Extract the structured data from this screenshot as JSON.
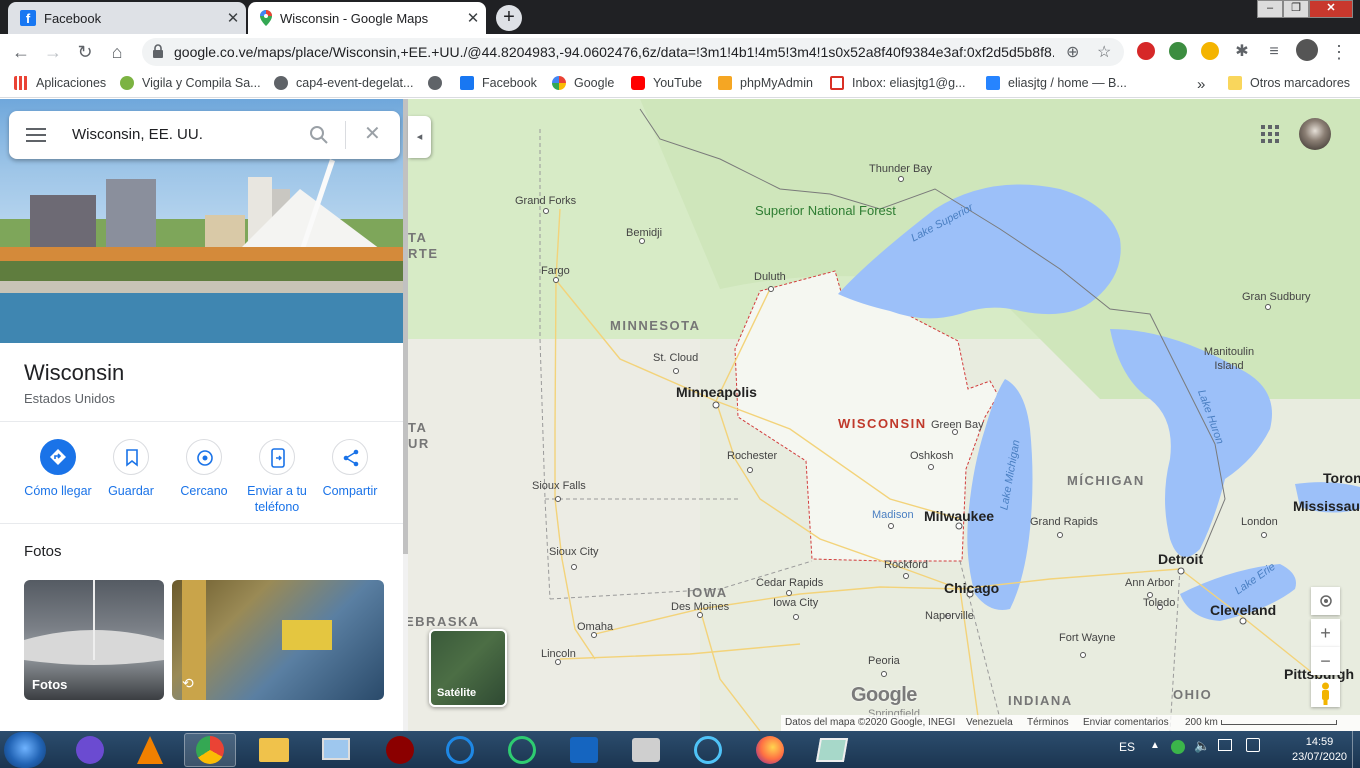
{
  "browser": {
    "tabs": [
      {
        "title": "Facebook"
      },
      {
        "title": "Wisconsin - Google Maps"
      }
    ],
    "url": "google.co.ve/maps/place/Wisconsin,+EE.+UU./@44.8204983,-94.0602476,6z/data=!3m1!4b1!4m5!3m4!1s0x52a8f40f9384e3af:0xf2d5d5b8f8...",
    "bookmarks": [
      "Aplicaciones",
      "Vigila y Compila Sa...",
      "cap4-event-degelat...",
      "Facebook",
      "Google",
      "YouTube",
      "phpMyAdmin",
      "Inbox: eliasjtg1@g...",
      "eliasjtg / home — B...",
      "Otros marcadores"
    ],
    "bookmarks_overflow": "»"
  },
  "panel": {
    "search_value": "Wisconsin, EE. UU.",
    "place_name": "Wisconsin",
    "place_subtitle": "Estados Unidos",
    "actions": [
      "Cómo llegar",
      "Guardar",
      "Cercano",
      "Enviar a tu teléfono",
      "Compartir"
    ],
    "photos_heading": "Fotos",
    "photo_label": "Fotos",
    "accent_color": "#1a73e8"
  },
  "map": {
    "states": [
      "MINNESOTA",
      "WISCONSIN",
      "IOWA",
      "MÍCHIGAN",
      "INDIANA",
      "OHIO",
      "EBRASKA"
    ],
    "edge_fragments": [
      "TA",
      "RTE",
      "TA",
      "UR"
    ],
    "cities_small": [
      "Thunder Bay",
      "Grand Forks",
      "Bemidji",
      "Fargo",
      "Duluth",
      "St. Cloud",
      "Rochester",
      "Sioux Falls",
      "Sioux City",
      "Omaha",
      "Lincoln",
      "Des Moines",
      "Cedar Rapids",
      "Iowa City",
      "Rockford",
      "Naperville",
      "Peoria",
      "Green Bay",
      "Oshkosh",
      "Grand Rapids",
      "Ann Arbor",
      "Toledo",
      "Fort Wayne",
      "London",
      "Gran Sudbury",
      "Manitoulin Island"
    ],
    "cities_large": [
      "Minneapolis",
      "Milwaukee",
      "Chicago",
      "Detroit",
      "Cleveland",
      "Pittsburgh",
      "Toron",
      "Mississau"
    ],
    "capital": "Madison",
    "water": [
      "Lake Superior",
      "Lake Michigan",
      "Lake Huron",
      "Lake Erie"
    ],
    "park": "Superior National Forest",
    "partial_label": "Springfield",
    "satellite_label": "Satélite",
    "logo": "Google",
    "attribution": {
      "data": "Datos del mapa ©2020 Google, INEGI",
      "country": "Venezuela",
      "terms": "Términos",
      "feedback": "Enviar comentarios",
      "scale": "200 km"
    }
  },
  "taskbar": {
    "language": "ES",
    "time": "14:59",
    "date": "23/07/2020"
  }
}
